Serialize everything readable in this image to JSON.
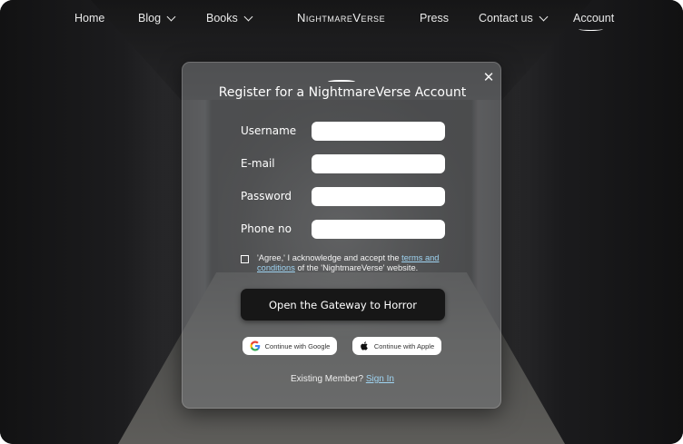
{
  "nav": {
    "home": "Home",
    "blog": "Blog",
    "books": "Books",
    "brand": "NightmareVerse",
    "press": "Press",
    "contact": "Contact us",
    "account": "Account"
  },
  "modal": {
    "title": "Register for a NightmareVerse Account",
    "fields": [
      {
        "label": "Username",
        "value": "",
        "placeholder": ""
      },
      {
        "label": "E-mail",
        "value": "",
        "placeholder": ""
      },
      {
        "label": "Password",
        "value": "",
        "placeholder": ""
      },
      {
        "label": "Phone no",
        "value": "",
        "placeholder": ""
      }
    ],
    "agree_prefix": "'Agree,' I acknowledge and accept the",
    "agree_link": "terms and conditions",
    "agree_suffix": "of the 'NightmareVerse' website.",
    "submit_label": "Open the Gateway to Horror",
    "google_label": "Continue with Google",
    "apple_label": "Continue with Apple",
    "existing_prefix": "Existing Member?",
    "sign_in_label": "Sign In",
    "close_glyph": "✕"
  },
  "colors": {
    "accent_link": "#9fd4f2",
    "submit_bg": "#171717"
  },
  "icons": {
    "close": "close-icon",
    "google": "google-icon",
    "apple": "apple-icon",
    "dropdown": "chevron-down-icon"
  }
}
